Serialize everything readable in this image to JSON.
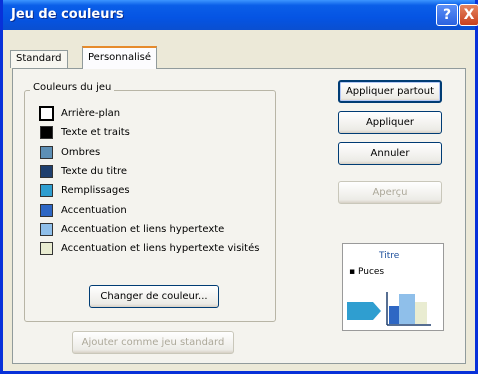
{
  "window": {
    "title": "Jeu de couleurs"
  },
  "titlebar_buttons": {
    "help": "?",
    "close": "X"
  },
  "tabs": [
    {
      "label": "Standard",
      "selected": false
    },
    {
      "label": "Personnalisé",
      "selected": true
    }
  ],
  "colors_group": {
    "label": "Couleurs du jeu",
    "items": [
      {
        "label": "Arrière-plan",
        "color": "#ffffff"
      },
      {
        "label": "Texte et traits",
        "color": "#000000"
      },
      {
        "label": "Ombres",
        "color": "#5d8fb5"
      },
      {
        "label": "Texte du titre",
        "color": "#1f3f6e"
      },
      {
        "label": "Remplissages",
        "color": "#2f9ed0"
      },
      {
        "label": "Accentuation",
        "color": "#2e67c4"
      },
      {
        "label": "Accentuation et liens hypertexte",
        "color": "#8fbfea"
      },
      {
        "label": "Accentuation et liens hypertexte visités",
        "color": "#e9ecd1"
      }
    ],
    "change_button": "Changer de couleur..."
  },
  "add_standard_button": "Ajouter comme jeu standard",
  "buttons": {
    "apply_all": "Appliquer partout",
    "apply": "Appliquer",
    "cancel": "Annuler",
    "preview": "Aperçu"
  },
  "preview": {
    "title": "Titre",
    "bullet": "Puces",
    "colors": {
      "arrow": "#2f9ed0",
      "bar1": "#2e67c4",
      "bar2": "#8fbfea",
      "bar3": "#e9ecd1",
      "axis": "#1f3f6e"
    }
  }
}
